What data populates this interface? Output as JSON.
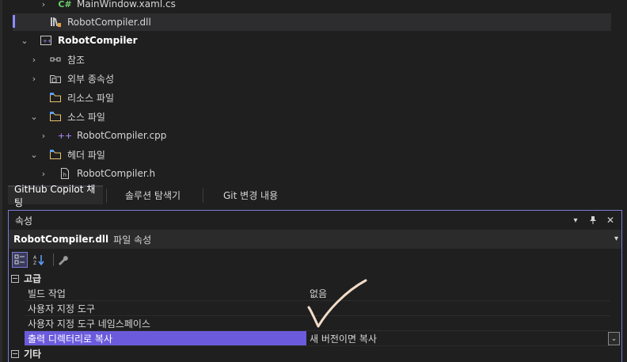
{
  "tree": {
    "items": [
      {
        "label": "MainWindow.xaml.cs",
        "icon": "csharp-file-icon",
        "icon_text": "C#",
        "expander": "collapsed"
      },
      {
        "label": "RobotCompiler.dll",
        "icon": "library-icon",
        "icon_text": "",
        "expander": "none"
      },
      {
        "label": "RobotCompiler",
        "icon": "cpp-project-icon",
        "icon_text": "",
        "expander": "expanded"
      },
      {
        "label": "참조",
        "icon": "references-icon",
        "icon_text": "",
        "expander": "collapsed"
      },
      {
        "label": "외부 종속성",
        "icon": "external-deps-folder-icon",
        "icon_text": "",
        "expander": "collapsed"
      },
      {
        "label": "리소스 파일",
        "icon": "filter-folder-icon",
        "icon_text": "",
        "expander": "none"
      },
      {
        "label": "소스 파일",
        "icon": "filter-folder-icon",
        "icon_text": "",
        "expander": "expanded"
      },
      {
        "label": "RobotCompiler.cpp",
        "icon": "cpp-file-icon",
        "icon_text": "++",
        "expander": "collapsed"
      },
      {
        "label": "헤더 파일",
        "icon": "filter-folder-icon",
        "icon_text": "",
        "expander": "expanded"
      },
      {
        "label": "RobotCompiler.h",
        "icon": "header-file-icon",
        "icon_text": "h",
        "expander": "collapsed"
      }
    ]
  },
  "tabs": [
    {
      "label": "GitHub Copilot 채팅",
      "active": true
    },
    {
      "label": "솔루션 탐색기",
      "active": false
    },
    {
      "label": "Git 변경 내용",
      "active": false
    }
  ],
  "properties": {
    "title": "속성",
    "object_name": "RobotCompiler.dll",
    "object_kind": "파일 속성",
    "categories": [
      {
        "name": "고급",
        "rows": [
          {
            "name": "빌드 작업",
            "value": "없음"
          },
          {
            "name": "사용자 지정 도구",
            "value": ""
          },
          {
            "name": "사용자 지정 도구 네임스페이스",
            "value": ""
          },
          {
            "name": "출력 디렉터리로 복사",
            "value": "새 버전이면 복사"
          }
        ]
      },
      {
        "name": "기타",
        "rows": []
      }
    ]
  },
  "colors": {
    "accent": "#7b7bd6",
    "selection": "#6b5bdc",
    "background": "#1f1f1f",
    "checkmark": "#f2dcc8"
  }
}
